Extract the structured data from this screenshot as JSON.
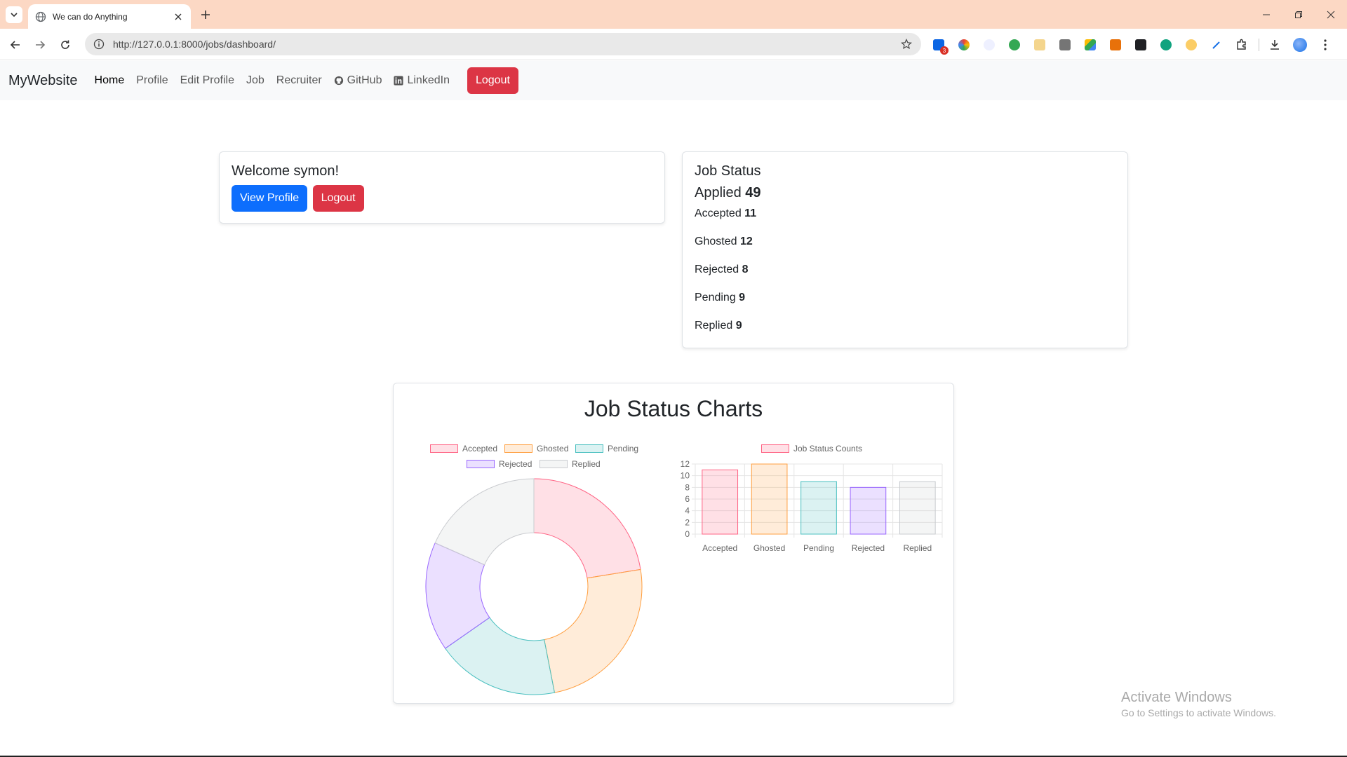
{
  "browser": {
    "tab_title": "We can do Anything",
    "url": "http://127.0.0.1:8000/jobs/dashboard/",
    "extension_badge": "3"
  },
  "navbar": {
    "brand": "MyWebsite",
    "links": [
      {
        "label": "Home",
        "active": true
      },
      {
        "label": "Profile",
        "active": false
      },
      {
        "label": "Edit Profile",
        "active": false
      },
      {
        "label": "Job",
        "active": false
      },
      {
        "label": "Recruiter",
        "active": false
      },
      {
        "label": "GitHub",
        "active": false,
        "icon": "github-icon"
      },
      {
        "label": "LinkedIn",
        "active": false,
        "icon": "linkedin-icon"
      }
    ],
    "logout_label": "Logout"
  },
  "welcome": {
    "heading": "Welcome symon!",
    "view_profile_label": "View Profile",
    "logout_label": "Logout"
  },
  "job_status": {
    "heading": "Job Status",
    "applied_label": "Applied",
    "applied_value": "49",
    "rows": [
      {
        "label": "Accepted",
        "value": "11"
      },
      {
        "label": "Ghosted",
        "value": "12"
      },
      {
        "label": "Rejected",
        "value": "8"
      },
      {
        "label": "Pending",
        "value": "9"
      },
      {
        "label": "Replied",
        "value": "9"
      }
    ]
  },
  "charts": {
    "title": "Job Status Charts"
  },
  "colors": {
    "danger": "#dc3545",
    "primary": "#0d6efd",
    "accepted": "#ff6384",
    "ghosted": "#ff9f40",
    "pending": "#4bc0c0",
    "rejected": "#9966ff",
    "replied": "#c9cbcf"
  },
  "chart_data": [
    {
      "type": "doughnut",
      "legend_position": "top",
      "categories": [
        "Accepted",
        "Ghosted",
        "Pending",
        "Rejected",
        "Replied"
      ],
      "values": [
        11,
        12,
        9,
        8,
        9
      ],
      "colors": [
        "#ff6384",
        "#ff9f40",
        "#4bc0c0",
        "#9966ff",
        "#c9cbcf"
      ]
    },
    {
      "type": "bar",
      "legend_position": "top",
      "categories": [
        "Accepted",
        "Ghosted",
        "Pending",
        "Rejected",
        "Replied"
      ],
      "series": [
        {
          "name": "Job Status Counts",
          "values": [
            11,
            12,
            9,
            8,
            9
          ]
        }
      ],
      "colors": [
        "#ff6384",
        "#ff9f40",
        "#4bc0c0",
        "#9966ff",
        "#c9cbcf"
      ],
      "ylim": [
        0,
        12
      ],
      "yticks": [
        0,
        2,
        4,
        6,
        8,
        10,
        12
      ],
      "grid": true
    }
  ],
  "watermark": {
    "line1": "Activate Windows",
    "line2": "Go to Settings to activate Windows."
  }
}
